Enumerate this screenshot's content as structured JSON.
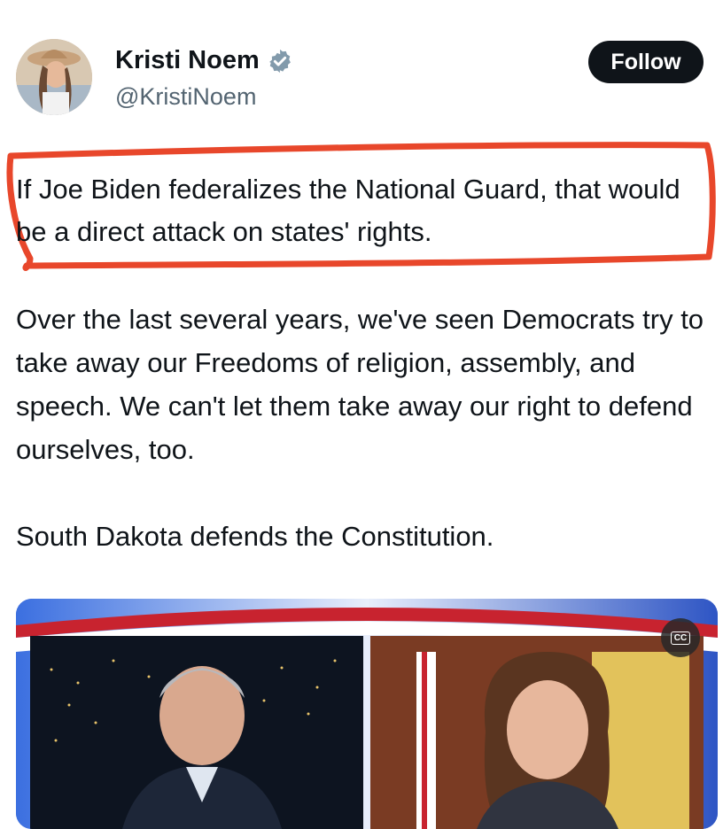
{
  "author": {
    "name": "Kristi Noem",
    "handle": "@KristiNoem",
    "verified": true,
    "avatar_icon": "avatar-photo"
  },
  "actions": {
    "follow_label": "Follow"
  },
  "tweet": {
    "highlighted_text": "If Joe Biden federalizes the National Guard, that would be a direct attack on states' rights.",
    "paragraphs": [
      "Over the last several years, we've seen Democrats try to take away our Freedoms of religion, assembly, and speech. We can't let them take away our right to defend ourselves, too.",
      "South Dakota defends the Constitution."
    ]
  },
  "media": {
    "cc_label": "CC",
    "cc_icon": "closed-captions-icon"
  },
  "colors": {
    "highlight": "#e8472b",
    "follow_bg": "#0f1419",
    "verified": "#829aab",
    "video_frame": "#2f59c7"
  }
}
